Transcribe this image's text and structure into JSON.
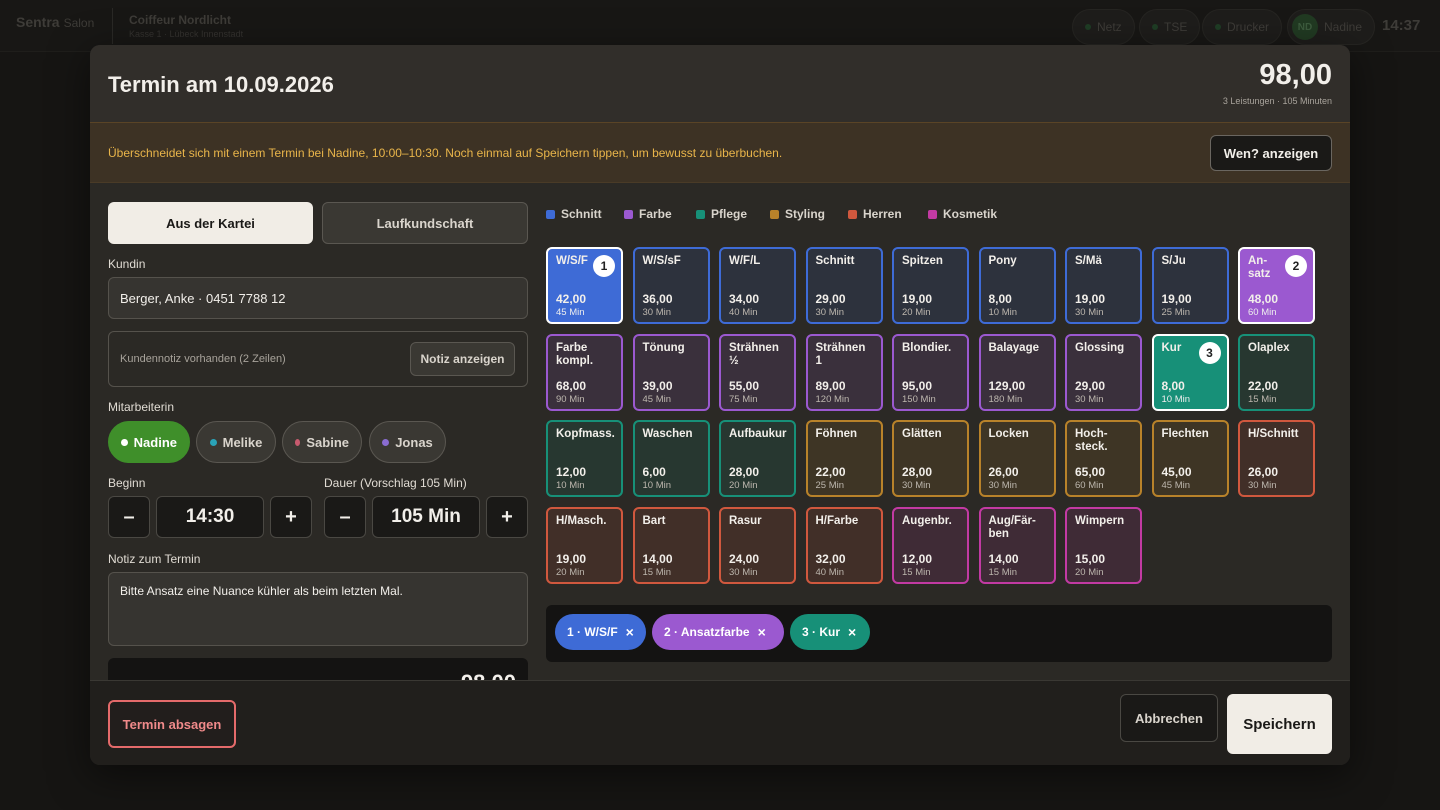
{
  "topbar": {
    "brand": "Sentra",
    "brand_sub": "Salon",
    "store_name": "Coiffeur Nordlicht",
    "store_sub": "Kasse 1 · Lübeck Innenstadt",
    "status": [
      "Netz",
      "TSE",
      "Drucker"
    ],
    "user_initials": "ND",
    "user_name": "Nadine",
    "time": "14:37"
  },
  "modal": {
    "title": "Termin am 10.09.2026",
    "total": "98,00",
    "summary": "3 Leistungen · 105 Minuten"
  },
  "warning": {
    "text": "Überschneidet sich mit einem Termin bei Nadine, 10:00–10:30. Noch einmal auf Speichern tippen, um bewusst zu überbuchen.",
    "button": "Wen? anzeigen"
  },
  "customer_tabs": [
    "Aus der Kartei",
    "Laufkundschaft"
  ],
  "customer": {
    "label": "Kundin",
    "value": "Berger, Anke · 0451 7788 12",
    "note_text": "Kundennotiz vorhanden (2 Zeilen)",
    "note_button": "Notiz anzeigen"
  },
  "staff": {
    "label": "Mitarbeiterin",
    "items": [
      {
        "name": "Nadine",
        "color": "#ffffff",
        "active": true
      },
      {
        "name": "Melike",
        "color": "#2aa3b8"
      },
      {
        "name": "Sabine",
        "color": "#c75a6e"
      },
      {
        "name": "Jonas",
        "color": "#8a6cd1"
      }
    ]
  },
  "time": {
    "begin_label": "Beginn",
    "begin": "14:30",
    "duration_label": "Dauer (Vorschlag 105 Min)",
    "duration": "105 Min",
    "minus": "–",
    "plus": "+"
  },
  "note": {
    "label": "Notiz zum Termin",
    "value": "Bitte Ansatz eine Nuance kühler als beim letzten Mal."
  },
  "hidden_total": "98,00",
  "categories": [
    {
      "name": "Schnitt",
      "color": "#3e6bd6"
    },
    {
      "name": "Farbe",
      "color": "#9b59d0"
    },
    {
      "name": "Pflege",
      "color": "#179078"
    },
    {
      "name": "Styling",
      "color": "#b8822a"
    },
    {
      "name": "Herren",
      "color": "#d0583e"
    },
    {
      "name": "Kosmetik",
      "color": "#c23aa3"
    }
  ],
  "services": [
    {
      "name": "W/S/F",
      "price": "42,00",
      "dur": "45 Min",
      "cat": 0,
      "badge": "1"
    },
    {
      "name": "W/S/sF",
      "price": "36,00",
      "dur": "30 Min",
      "cat": 0
    },
    {
      "name": "W/F/L",
      "price": "34,00",
      "dur": "40 Min",
      "cat": 0
    },
    {
      "name": "Schnitt",
      "price": "29,00",
      "dur": "30 Min",
      "cat": 0
    },
    {
      "name": "Spitzen",
      "price": "19,00",
      "dur": "20 Min",
      "cat": 0
    },
    {
      "name": "Pony",
      "price": "8,00",
      "dur": "10 Min",
      "cat": 0
    },
    {
      "name": "S/Mä",
      "price": "19,00",
      "dur": "30 Min",
      "cat": 0
    },
    {
      "name": "S/Ju",
      "price": "19,00",
      "dur": "25 Min",
      "cat": 0
    },
    {
      "name": "An-\nsatz",
      "price": "48,00",
      "dur": "60 Min",
      "cat": 1,
      "badge": "2"
    },
    {
      "name": "Farbe\nkompl.",
      "price": "68,00",
      "dur": "90 Min",
      "cat": 1
    },
    {
      "name": "Tönung",
      "price": "39,00",
      "dur": "45 Min",
      "cat": 1
    },
    {
      "name": "Strähnen\n½",
      "price": "55,00",
      "dur": "75 Min",
      "cat": 1
    },
    {
      "name": "Strähnen 1",
      "price": "89,00",
      "dur": "120 Min",
      "cat": 1
    },
    {
      "name": "Blondier.",
      "price": "95,00",
      "dur": "150 Min",
      "cat": 1
    },
    {
      "name": "Balayage",
      "price": "129,00",
      "dur": "180 Min",
      "cat": 1
    },
    {
      "name": "Glossing",
      "price": "29,00",
      "dur": "30 Min",
      "cat": 1
    },
    {
      "name": "Kur",
      "price": "8,00",
      "dur": "10 Min",
      "cat": 2,
      "badge": "3"
    },
    {
      "name": "Olaplex",
      "price": "22,00",
      "dur": "15 Min",
      "cat": 2
    },
    {
      "name": "Kopfmass.",
      "price": "12,00",
      "dur": "10 Min",
      "cat": 2
    },
    {
      "name": "Waschen",
      "price": "6,00",
      "dur": "10 Min",
      "cat": 2
    },
    {
      "name": "Aufbaukur",
      "price": "28,00",
      "dur": "20 Min",
      "cat": 2
    },
    {
      "name": "Föhnen",
      "price": "22,00",
      "dur": "25 Min",
      "cat": 3
    },
    {
      "name": "Glätten",
      "price": "28,00",
      "dur": "30 Min",
      "cat": 3
    },
    {
      "name": "Locken",
      "price": "26,00",
      "dur": "30 Min",
      "cat": 3
    },
    {
      "name": "Hoch-\nsteck.",
      "price": "65,00",
      "dur": "60 Min",
      "cat": 3
    },
    {
      "name": "Flechten",
      "price": "45,00",
      "dur": "45 Min",
      "cat": 3
    },
    {
      "name": "H/Schnitt",
      "price": "26,00",
      "dur": "30 Min",
      "cat": 4
    },
    {
      "name": "H/Masch.",
      "price": "19,00",
      "dur": "20 Min",
      "cat": 4
    },
    {
      "name": "Bart",
      "price": "14,00",
      "dur": "15 Min",
      "cat": 4
    },
    {
      "name": "Rasur",
      "price": "24,00",
      "dur": "30 Min",
      "cat": 4
    },
    {
      "name": "H/Farbe",
      "price": "32,00",
      "dur": "40 Min",
      "cat": 4
    },
    {
      "name": "Augenbr.",
      "price": "12,00",
      "dur": "15 Min",
      "cat": 5
    },
    {
      "name": "Aug/Fär-\nben",
      "price": "14,00",
      "dur": "15 Min",
      "cat": 5
    },
    {
      "name": "Wimpern",
      "price": "15,00",
      "dur": "20 Min",
      "cat": 5
    }
  ],
  "selected": [
    {
      "label": "1 · W/S/F",
      "cat": 0
    },
    {
      "label": "2 · Ansatzfarbe",
      "cat": 1
    },
    {
      "label": "3 · Kur",
      "cat": 2
    }
  ],
  "remove_icon": "×",
  "footer": {
    "cancel_appt": "Termin absagen",
    "abort": "Abbrechen",
    "save": "Speichern"
  }
}
